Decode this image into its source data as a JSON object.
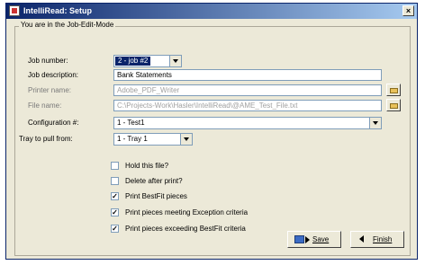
{
  "window": {
    "title": "IntelliRead: Setup",
    "close_glyph": "×"
  },
  "group": {
    "label": "You are in the Job-Edit-Mode"
  },
  "form": {
    "job_number": {
      "label": "Job number:",
      "value": "2 - job #2"
    },
    "job_description": {
      "label": "Job description:",
      "value": "Bank Statements"
    },
    "printer_name": {
      "label": "Printer name:",
      "value": "Adobe_PDF_Writer"
    },
    "file_name": {
      "label": "File name:",
      "value": "C:\\Projects-Work\\Hasler\\IntelliRead\\@AME_Test_File.txt"
    },
    "configuration": {
      "label": "Configuration #:",
      "value": "1 - Test1"
    },
    "tray": {
      "label": "Tray to pull from:",
      "value": "1 - Tray 1"
    }
  },
  "checkboxes": [
    {
      "label": "Hold this file?",
      "checked": false
    },
    {
      "label": "Delete after print?",
      "checked": false
    },
    {
      "label": "Print BestFit pieces",
      "checked": true
    },
    {
      "label": "Print pieces meeting Exception criteria",
      "checked": true
    },
    {
      "label": "Print pieces exceeding BestFit criteria",
      "checked": true
    }
  ],
  "check_mark": "✓",
  "buttons": {
    "save": "Save",
    "finish": "Finish"
  },
  "icons": {
    "app": "app-icon",
    "browse": "folder-open-icon",
    "save": "save-arrow-icon",
    "finish": "left-arrow-icon"
  }
}
